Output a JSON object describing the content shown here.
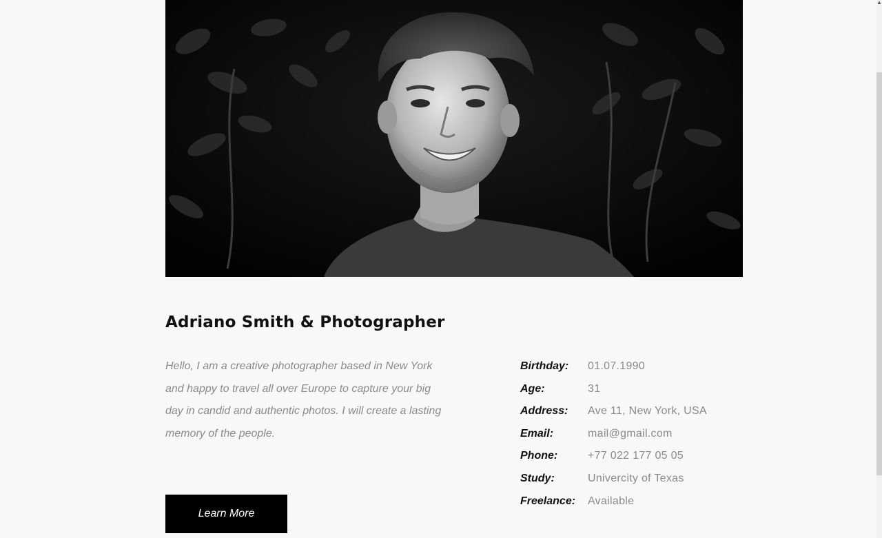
{
  "profile": {
    "name": "Adriano Smith & Photographer",
    "bio": "Hello, I am a creative photographer based in New York and happy to travel all over Europe to capture your big day in candid and authentic photos. I will create a lasting memory of the people.",
    "cta_label": "Learn More"
  },
  "details": [
    {
      "label": "Birthday:",
      "value": "01.07.1990"
    },
    {
      "label": "Age:",
      "value": "31"
    },
    {
      "label": "Address:",
      "value": "Ave 11, New York, USA"
    },
    {
      "label": "Email:",
      "value": "mail@gmail.com"
    },
    {
      "label": "Phone:",
      "value": "+77 022 177 05 05"
    },
    {
      "label": "Study:",
      "value": "Univercity of Texas"
    },
    {
      "label": "Freelance:",
      "value": "Available"
    }
  ],
  "colors": {
    "background": "#f8f8f8",
    "heading": "#111111",
    "muted_text": "#8a8a8a",
    "button_bg": "#000000",
    "button_text": "#ffffff"
  },
  "icons": {
    "scroll_up": "scroll-up-arrow-icon"
  }
}
